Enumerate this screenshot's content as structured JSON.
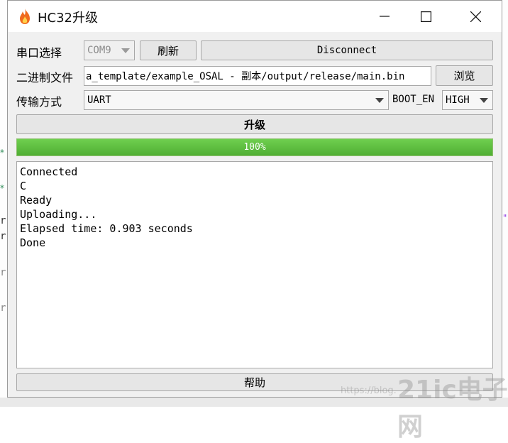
{
  "window": {
    "title": "HC32升级"
  },
  "controls": {
    "serial_label": "串口选择",
    "port_value": "COM9",
    "refresh_label": "刷新",
    "disconnect_label": "Disconnect",
    "binary_label": "二进制文件",
    "binary_path": "a_template/example_OSAL - 副本/output/release/main.bin",
    "browse_label": "浏览",
    "transfer_label": "传输方式",
    "transfer_value": "UART",
    "boot_label": "BOOT_EN",
    "boot_value": "HIGH",
    "upgrade_label": "升级",
    "progress_text": "100%",
    "progress_value": 1.0,
    "help_label": "帮助"
  },
  "log": {
    "lines": [
      "Connected",
      "C",
      "Ready",
      "Uploading...",
      "Elapsed time: 0.903 seconds",
      "Done"
    ]
  },
  "watermark": {
    "brand": "21ic电子网",
    "url": "https://blog."
  },
  "colors": {
    "progress_fill": "#5cb85c",
    "accent_flame": "#f06a1d"
  }
}
